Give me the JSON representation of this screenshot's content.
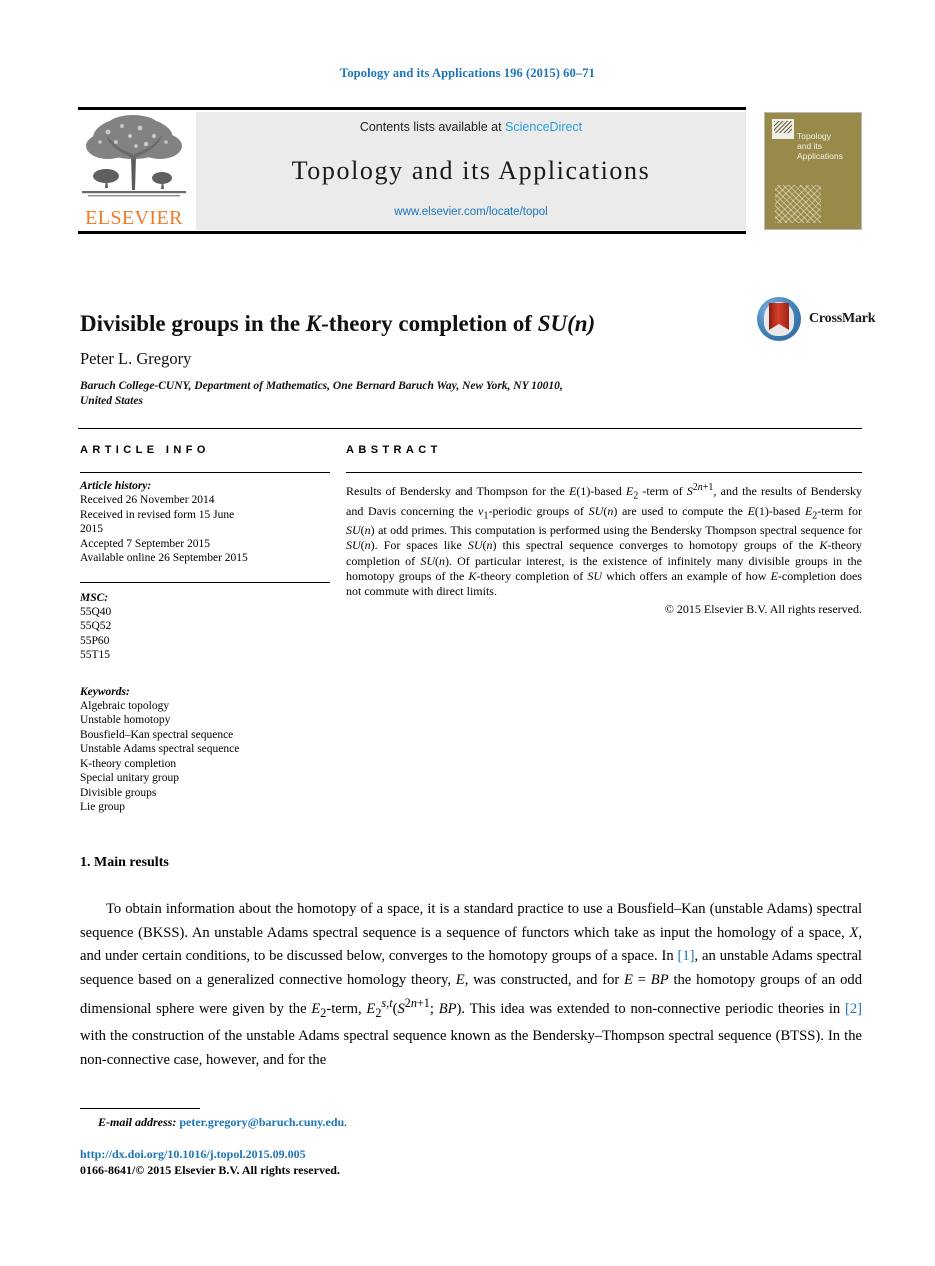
{
  "running_head": "Topology and its Applications 196 (2015) 60–71",
  "masthead": {
    "contents_prefix": "Contents lists available at ",
    "sciencedirect": "ScienceDirect",
    "journal_title": "Topology and its Applications",
    "journal_url": "www.elsevier.com/locate/topol",
    "publisher_logo_word": "ELSEVIER",
    "cover_title_line1": "Topology",
    "cover_title_line2": "and its",
    "cover_title_line3": "Applications"
  },
  "article": {
    "title_part1": "Divisible groups in the ",
    "title_math_k": "K",
    "title_part2": "-theory completion of ",
    "title_math_su": "SU",
    "title_part3": "(n)",
    "crossmark_label": "CrossMark",
    "author": "Peter L. Gregory",
    "affiliation_line1": "Baruch College-CUNY, Department of Mathematics, One Bernard Baruch Way, New York, NY 10010,",
    "affiliation_line2": "United States"
  },
  "info": {
    "heading": "ARTICLE INFO",
    "history_label": "Article history:",
    "history": [
      "Received 26 November 2014",
      "Received in revised form 15 June",
      "2015",
      "Accepted 7 September 2015",
      "Available online 26 September 2015"
    ],
    "msc_label": "MSC:",
    "msc": [
      "55Q40",
      "55Q52",
      "55P60",
      "55T15"
    ],
    "keywords_label": "Keywords:",
    "keywords": [
      "Algebraic topology",
      "Unstable homotopy",
      "Bousfield–Kan spectral sequence",
      "Unstable Adams spectral sequence",
      "K-theory completion",
      "Special unitary group",
      "Divisible groups",
      "Lie group"
    ]
  },
  "abstract": {
    "heading": "ABSTRACT",
    "text": "Results of Bendersky and Thompson for the E(1)-based E₂ -term of S²ⁿ⁺¹, and the results of Bendersky and Davis concerning the v₁-periodic groups of SU(n) are used to compute the E(1)-based E₂-term for SU(n) at odd primes. This computation is performed using the Bendersky Thompson spectral sequence for SU(n). For spaces like SU(n) this spectral sequence converges to homotopy groups of the K-theory completion of SU(n). Of particular interest, is the existence of infinitely many divisible groups in the homotopy groups of the K-theory completion of SU which offers an example of how E-completion does not commute with direct limits.",
    "copyright": "© 2015 Elsevier B.V. All rights reserved."
  },
  "body": {
    "section_number_title": "1. Main results",
    "paragraph": "To obtain information about the homotopy of a space, it is a standard practice to use a Bousfield–Kan (unstable Adams) spectral sequence (BKSS). An unstable Adams spectral sequence is a sequence of functors which take as input the homology of a space, X, and under certain conditions, to be discussed below, converges to the homotopy groups of a space. In [1], an unstable Adams spectral sequence based on a generalized connective homology theory, E, was constructed, and for E = BP the homotopy groups of an odd dimensional sphere were given by the E₂-term, E₂^{s,t}(S^{2n+1}; BP). This idea was extended to non-connective periodic theories in [2] with the construction of the unstable Adams spectral sequence known as the Bendersky–Thompson spectral sequence (BTSS). In the non-connective case, however, and for the",
    "ref1": "[1]",
    "ref2": "[2]"
  },
  "footer": {
    "email_label": "E-mail address:",
    "email": "peter.gregory@baruch.cuny.edu",
    "email_period": ".",
    "doi": "http://dx.doi.org/10.1016/j.topol.2015.09.005",
    "issn_copyright": "0166-8641/© 2015 Elsevier B.V. All rights reserved."
  },
  "colors": {
    "link_blue": "#1b75b8",
    "sciencedirect_blue": "#2a9fd6",
    "elsevier_orange": "#ec7c26",
    "masthead_grey": "#ebebeb",
    "cover_olive": "#9a8a4a"
  }
}
